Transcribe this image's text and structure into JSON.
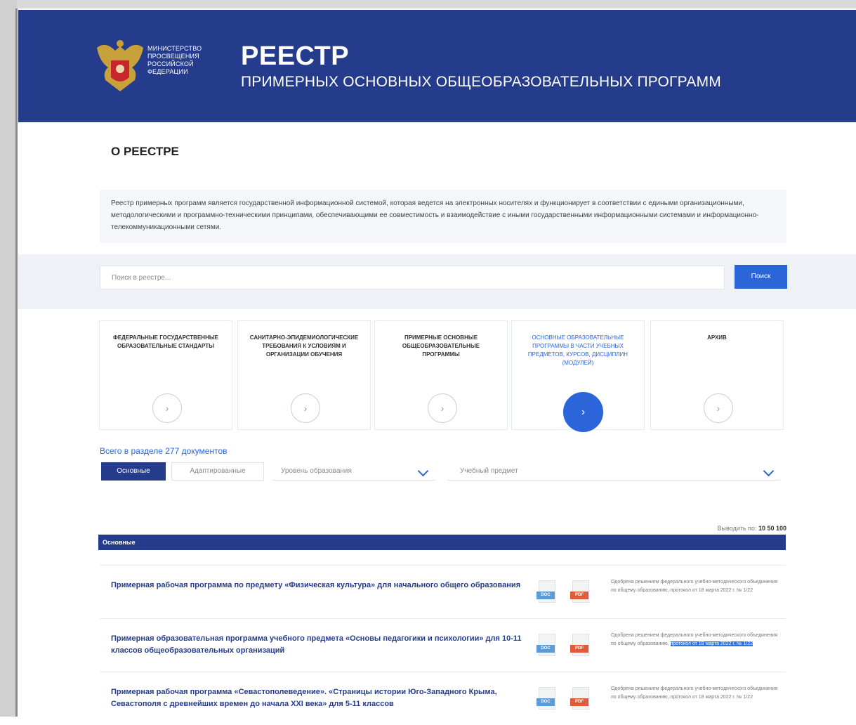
{
  "header": {
    "ministry_lines": [
      "МИНИСТЕРСТВО",
      "ПРОСВЕЩЕНИЯ",
      "РОССИЙСКОЙ",
      "ФЕДЕРАЦИИ"
    ],
    "title": "РЕЕСТР",
    "subtitle": "ПРИМЕРНЫХ ОСНОВНЫХ ОБЩЕОБРАЗОВАТЕЛЬНЫХ ПРОГРАММ"
  },
  "about": {
    "title": "О РЕЕСТРЕ",
    "text": "Реестр примерных программ является государственной информационной системой, которая ведется на электронных носителях и функционирует в соответствии с едиными организационными, методологическими и программно-техническими принципами, обеспечивающими ее совместимость и взаимодействие с иными государственными информационными системами и информационно-телекоммуникационными сетями."
  },
  "search": {
    "placeholder": "Поиск в реестре...",
    "button_label": "Поиск"
  },
  "categories": [
    {
      "label": "ФЕДЕРАЛЬНЫЕ ГОСУДАРСТВЕННЫЕ ОБРАЗОВАТЕЛЬНЫЕ СТАНДАРТЫ",
      "active": false
    },
    {
      "label": "САНИТАРНО-ЭПИДЕМИОЛОГИЧЕСКИЕ ТРЕБОВАНИЯ К УСЛОВИЯМ И ОРГАНИЗАЦИИ ОБУЧЕНИЯ",
      "active": false
    },
    {
      "label": "ПРИМЕРНЫЕ ОСНОВНЫЕ ОБЩЕОБРАЗОВАТЕЛЬНЫЕ ПРОГРАММЫ",
      "active": false
    },
    {
      "label": "ОСНОВНЫЕ ОБРАЗОВАТЕЛЬНЫЕ ПРОГРАММЫ В ЧАСТИ УЧЕБНЫХ ПРЕДМЕТОВ, КУРСОВ, ДИСЦИПЛИН (МОДУЛЕЙ)",
      "active": true
    },
    {
      "label": "АРХИВ",
      "active": false
    }
  ],
  "circle_arrow": "›",
  "documents": {
    "count_text": "Всего в разделе 277 документов",
    "tab_main": "Основные",
    "tab_adapted": "Адаптированные",
    "filter_level": "Уровень образования",
    "filter_subject": "Учебный предмет",
    "per_page_label": "Выводить по:",
    "per_page_options": "10 50 100",
    "table_header": "Основные",
    "rows": [
      {
        "title": "Примерная рабочая программа по предмету «Физическая культура» для начального общего образования",
        "approval": "Одобрена решением федерального учебно-методического объединения по общему образованию, протокол от 18 марта 2022 г. № 1/22",
        "approval_highlight": ""
      },
      {
        "title": "Примерная образовательная программа учебного предмета «Основы педагогики и психологии» для 10-11 классов общеобразовательных организаций",
        "approval": "Одобрена решением федерального учебно-методического объединения по общему образованию, ",
        "approval_highlight": "протокол от 18 марта 2022 г. № 1/22"
      },
      {
        "title": "Примерная рабочая программа «Севастополеведение». «Страницы истории Юго-Западного Крыма, Севастополя с древнейших времен до начала XXI века» для 5-11 классов",
        "approval": "Одобрена решением федерального учебно-методического объединения по общему образованию, протокол от 18 марта 2022 г. № 1/22",
        "approval_highlight": ""
      }
    ],
    "doc_tag": "DOC",
    "pdf_tag": "PDF"
  },
  "colors": {
    "header_bg": "#253c8c",
    "accent": "#2b65d9",
    "pdf": "#e05a3c",
    "doc": "#5a9bd8"
  }
}
